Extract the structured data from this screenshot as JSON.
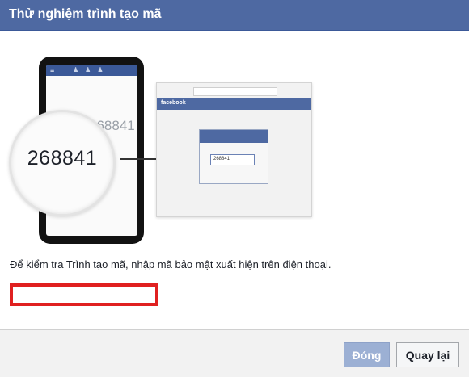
{
  "dialog": {
    "title": "Thử nghiệm trình tạo mã",
    "instruction": "Để kiểm tra Trình tạo mã, nhập mã bảo mật xuất hiện trên điện thoại.",
    "code_input_value": "",
    "close_button": "Đóng",
    "back_button": "Quay lại"
  },
  "illustration": {
    "phone_code": "268841",
    "magnified_code": "268841",
    "browser_brand": "facebook",
    "browser_input_code": "268841"
  },
  "colors": {
    "header": "#4e69a2",
    "highlight_border": "#e02020",
    "disabled_button": "#9cb0d4"
  }
}
